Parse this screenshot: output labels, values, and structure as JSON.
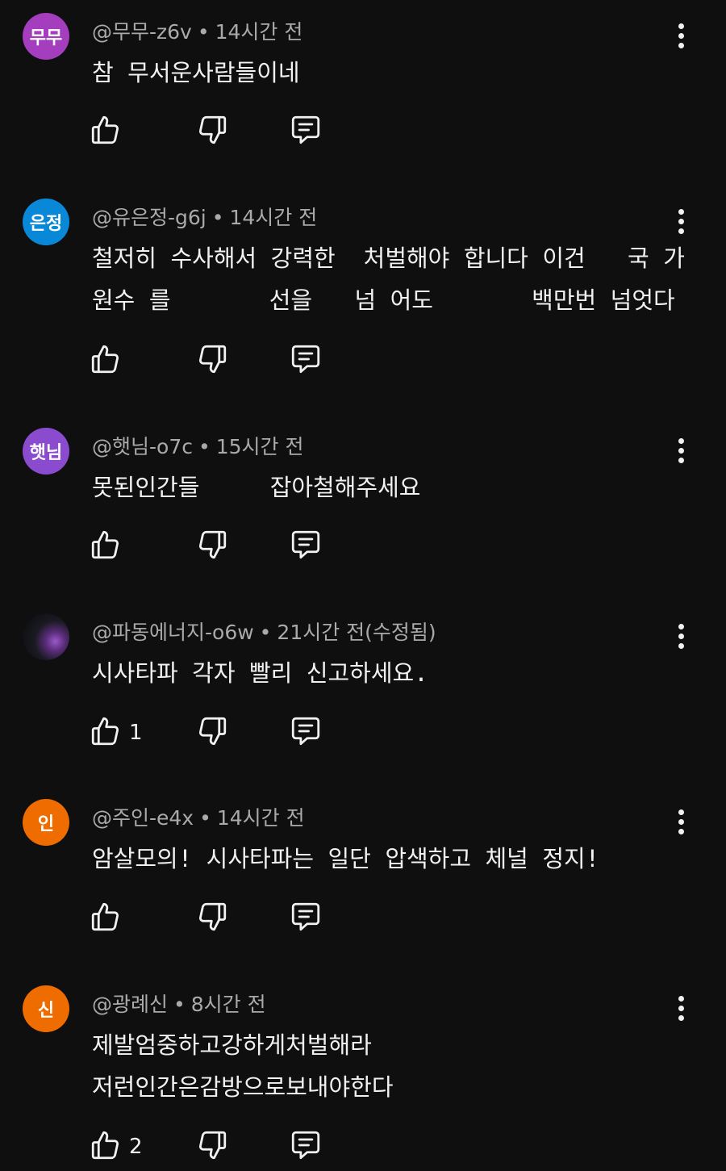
{
  "comments": [
    {
      "avatar_text": "무무",
      "avatar_color": "#a53dbf",
      "author": "@무무-z6v",
      "time": "14시간 전",
      "text": "참 무서운사람들이네",
      "likes": ""
    },
    {
      "avatar_text": "은정",
      "avatar_color": "#0a88d8",
      "author": "@유은정-g6j",
      "time": "14시간 전",
      "text": "철저히 수사해서 강력한  처벌해야 합니다 이건   국 가\n원수 를       선을   넘 어도       백만번 넘엇다",
      "likes": ""
    },
    {
      "avatar_text": "햇님",
      "avatar_color": "#8a4bcf",
      "author": "@햇님-o7c",
      "time": "15시간 전",
      "text": "못된인간들     잡아철해주세요",
      "likes": ""
    },
    {
      "avatar_text": "",
      "avatar_color": "#14131a",
      "author": "@파동에너지-o6w",
      "time": "21시간 전(수정됨)",
      "text": "시사타파 각자 빨리 신고하세요.",
      "likes": "1"
    },
    {
      "avatar_text": "인",
      "avatar_color": "#ef6c00",
      "author": "@주인-e4x",
      "time": "14시간 전",
      "text": "암살모의! 시사타파는 일단 압색하고 체널 정지!",
      "likes": ""
    },
    {
      "avatar_text": "신",
      "avatar_color": "#ef6c00",
      "author": "@광례신",
      "time": "8시간 전",
      "text": "제발엄중하고강하게처벌해라\n저런인간은감방으로보내야한다",
      "likes": "2"
    }
  ],
  "icons": {
    "like": "thumbs-up-icon",
    "dislike": "thumbs-down-icon",
    "reply": "reply-icon",
    "menu": "more-vert-icon"
  }
}
